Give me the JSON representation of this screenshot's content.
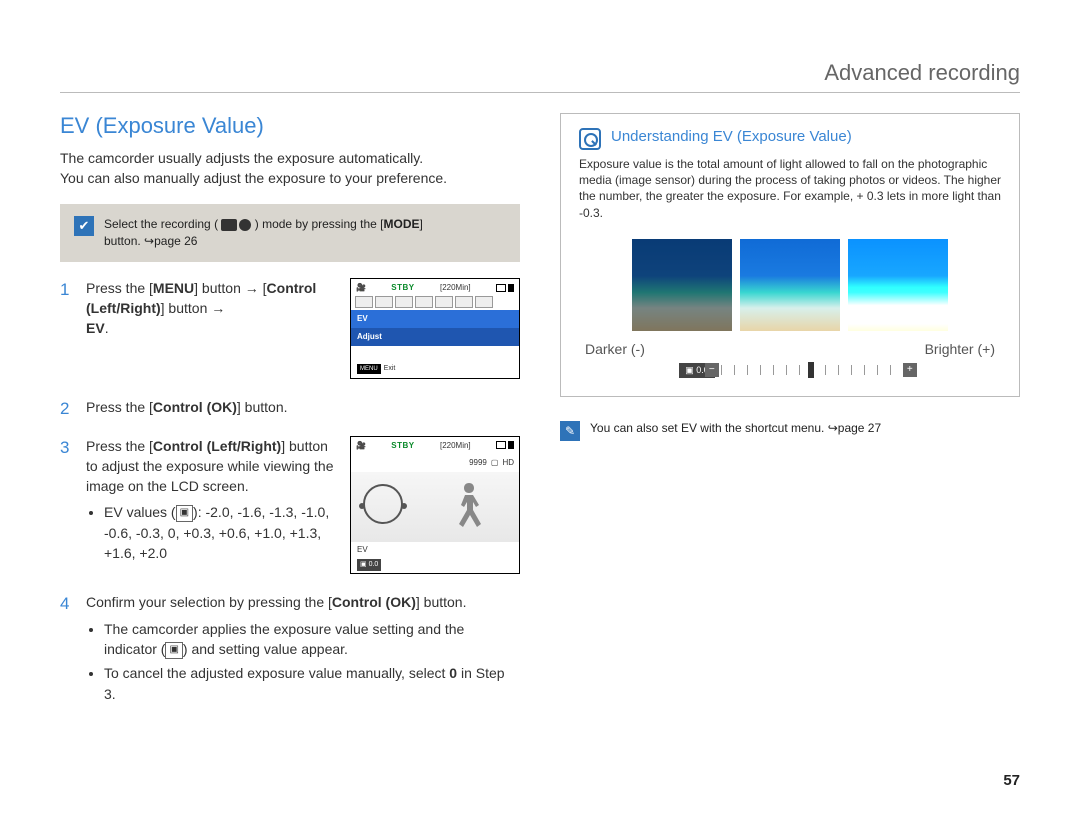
{
  "header": {
    "title": "Advanced recording"
  },
  "main": {
    "title": "EV (Exposure Value)",
    "intro1": "The camcorder usually adjusts the exposure automatically.",
    "intro2": "You can also manually adjust the exposure to your preference."
  },
  "note": {
    "text_pre": "Select the recording (",
    "text_post": ") mode by pressing the [",
    "mode_label": "MODE",
    "text_end": "]",
    "line2_pre": "button. ",
    "line2_page": "page 26"
  },
  "steps": {
    "s1_a": "Press the [",
    "s1_menu": "MENU",
    "s1_b": "] button → [",
    "s1_ctrl": "Control (Left/Right)",
    "s1_c": "] button → ",
    "s1_ev": "EV",
    "s1_d": ".",
    "s2_a": "Press the [",
    "s2_ok": "Control (OK)",
    "s2_b": "] button.",
    "s3_a": "Press the [",
    "s3_ctrl": "Control (Left/Right)",
    "s3_b": "] button to adjust the exposure while viewing the image on the LCD screen.",
    "s3_bullet_label": "EV values (",
    "s3_bullet_vals": "): -2.0, -1.6, -1.3, -1.0, -0.6, -0.3, 0, +0.3, +0.6, +1.0, +1.3, +1.6, +2.0",
    "s4_a": "Confirm your selection by pressing the [",
    "s4_ok": "Control (OK)",
    "s4_b": "] button.",
    "s4_bullet1_a": "The camcorder applies the exposure value setting and the indicator (",
    "s4_bullet1_b": ") and setting value appear.",
    "s4_bullet2_a": "To cancel the adjusted exposure value manually, select ",
    "s4_bullet2_zero": "0",
    "s4_bullet2_b": " in Step 3."
  },
  "lcd1": {
    "stby": "STBY",
    "time": "[220Min]",
    "row_ev": "EV",
    "row_adjust": "Adjust",
    "menu": "MENU",
    "exit": "Exit"
  },
  "lcd2": {
    "stby": "STBY",
    "time": "[220Min]",
    "shots": "9999",
    "ev_label": "EV",
    "ev_value": "0.0"
  },
  "sidebar": {
    "title": "Understanding EV (Exposure Value)",
    "body": "Exposure value is the total amount of light allowed to fall on the photographic media (image sensor) during the process of taking photos or videos. The higher the number, the greater the exposure. For example, + 0.3 lets in more light than -0.3.",
    "darker": "Darker (-)",
    "brighter": "Brighter (+)",
    "ev_badge": "0.0"
  },
  "tip": {
    "text_pre": "You can also set EV with the shortcut menu. ",
    "page": "page 27"
  },
  "page_number": "57"
}
